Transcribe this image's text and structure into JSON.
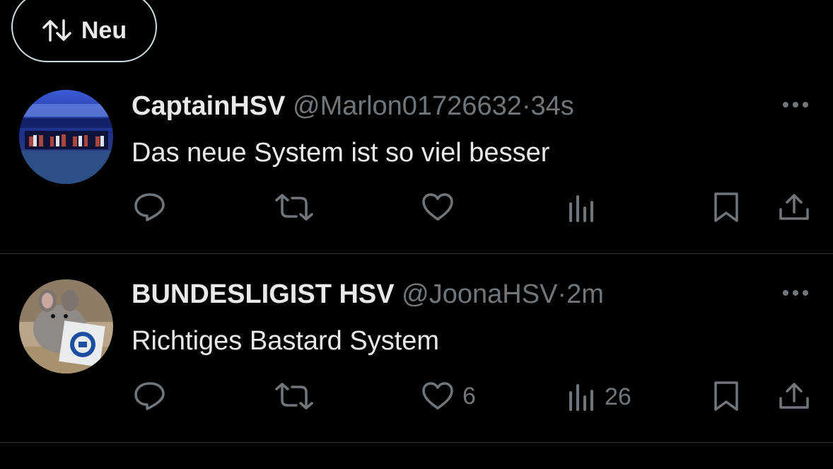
{
  "sort": {
    "label": "Neu",
    "icon": "sort-arrows-icon"
  },
  "tweets": [
    {
      "display_name": "CaptainHSV",
      "handle": "@Marlon01726632",
      "separator": "·",
      "time": "34s",
      "text": "Das neue System ist so viel besser",
      "avatar": "stadium-team-photo-avatar",
      "likes": "",
      "views": ""
    },
    {
      "display_name": "BUNDESLIGIST HSV",
      "handle": "@JoonaHSV",
      "separator": "·",
      "time": "2m",
      "text": "Richtiges Bastard System",
      "avatar": "chinchilla-hsv-avatar",
      "likes": "6",
      "views": "26"
    }
  ],
  "colors": {
    "background": "#000000",
    "text": "#e7e9ea",
    "secondary": "#71767b",
    "divider": "#2f3336"
  }
}
